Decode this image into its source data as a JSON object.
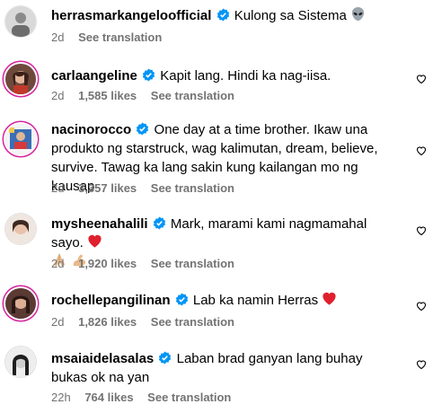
{
  "icons": {
    "verified": "verified-badge-icon",
    "like": "heart-outline-icon"
  },
  "colors": {
    "verified": "#0095f6",
    "meta_text": "#737373",
    "ring": "#d6249f",
    "red_heart": "#e0202e"
  },
  "comments": [
    {
      "username": "herrasmarkangeloofficial",
      "text": "Kulong sa Sistema",
      "emoji": "alien-icon",
      "time": "2d",
      "likes": "",
      "see_translation": "See translation"
    },
    {
      "username": "carlaangeline",
      "text": "Kapit lang. Hindi ka nag-iisa.",
      "emoji": "",
      "time": "2d",
      "likes": "1,585 likes",
      "see_translation": "See translation"
    },
    {
      "username": "nacinorocco",
      "text": "One day at a time brother. Ikaw una produkto ng starstruck, wag kalimutan, dream, believe, survive. Tawag ka lang sakin kung kailangan mo ng kausap",
      "emoji": "",
      "time": "2d",
      "likes": "3,357 likes",
      "see_translation": "See translation"
    },
    {
      "username": "mysheenahalili",
      "text": "Mark, marami kami nagmamahal sayo.",
      "emoji": "red-heart-icon, praying-hands-icon, flexed-biceps-icon",
      "time": "2d",
      "likes": "1,920 likes",
      "see_translation": "See translation"
    },
    {
      "username": "rochellepangilinan",
      "text": "Lab ka namin Herras",
      "emoji": "red-heart-icon",
      "time": "2d",
      "likes": "1,826 likes",
      "see_translation": "See translation"
    },
    {
      "username": "msaiaidelasalas",
      "text": "Laban brad ganyan lang buhay bukas ok na yan",
      "emoji": "",
      "time": "22h",
      "likes": "764 likes",
      "see_translation": "See translation"
    }
  ]
}
